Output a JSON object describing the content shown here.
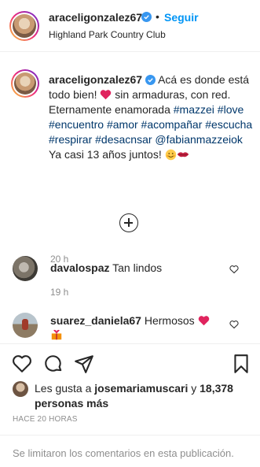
{
  "header": {
    "username": "araceligonzalez67",
    "separator": "•",
    "follow_label": "Seguir",
    "location": "Highland Park Country Club"
  },
  "caption": {
    "username": "araceligonzalez67",
    "text_1": " Acá es donde está todo bien! ",
    "text_2": " sin armaduras, con red. Eternamente enamorada ",
    "tags": [
      "#mazzei",
      "#love",
      "#encuentro",
      "#amor",
      "#acompañar",
      "#escucha",
      "#respirar",
      "#desacnsar"
    ],
    "mention": "@fabianmazzeiok",
    "text_3": " Ya casi 13 años juntos! ",
    "time": "20 h"
  },
  "comments": [
    {
      "username": "davalospaz",
      "text": "Tan lindos",
      "time": "19 h"
    },
    {
      "username": "suarez_daniela67",
      "text": "Hermosos"
    }
  ],
  "likes": {
    "prefix": "Les gusta a ",
    "user": "josemariamuscari",
    "middle": " y ",
    "count": "18,378 personas más"
  },
  "posted_ago": "HACE 20 HORAS",
  "comments_limited": "Se limitaron los comentarios en esta publicación.",
  "colors": {
    "link": "#0095f6",
    "hashtag": "#00376b",
    "verified": "#3897f0",
    "muted": "#8e8e8e",
    "heart": "#ed4956"
  },
  "icons": [
    "verified-badge-icon",
    "plus-circle-icon",
    "heart-outline-icon",
    "comment-icon",
    "share-icon",
    "bookmark-icon",
    "red-heart-emoji",
    "smiling-face-emoji",
    "kiss-emoji",
    "heart-gift-emoji"
  ]
}
